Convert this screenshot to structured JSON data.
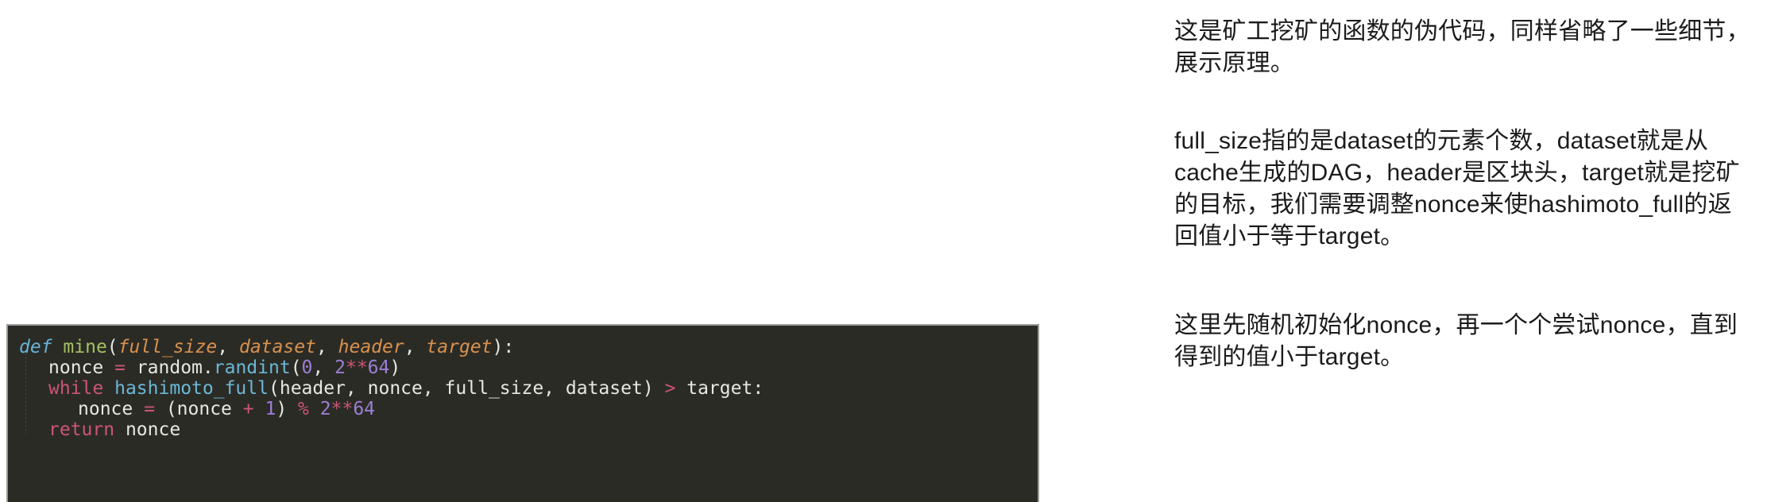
{
  "code_block": {
    "language": "python",
    "background_color": "#2B2B26",
    "lines": [
      {
        "indent": 0,
        "tokens": [
          {
            "t": "def",
            "c": "tk-def"
          },
          {
            "t": " ",
            "c": "tk-plain"
          },
          {
            "t": "mine",
            "c": "tk-fname"
          },
          {
            "t": "(",
            "c": "tk-punct"
          },
          {
            "t": "full_size",
            "c": "tk-param"
          },
          {
            "t": ", ",
            "c": "tk-punct"
          },
          {
            "t": "dataset",
            "c": "tk-param"
          },
          {
            "t": ", ",
            "c": "tk-punct"
          },
          {
            "t": "header",
            "c": "tk-param"
          },
          {
            "t": ", ",
            "c": "tk-punct"
          },
          {
            "t": "target",
            "c": "tk-param"
          },
          {
            "t": "):",
            "c": "tk-punct"
          }
        ]
      },
      {
        "indent": 1,
        "tokens": [
          {
            "t": "nonce",
            "c": "tk-plain"
          },
          {
            "t": " ",
            "c": "tk-plain"
          },
          {
            "t": "=",
            "c": "tk-op"
          },
          {
            "t": " random.",
            "c": "tk-plain"
          },
          {
            "t": "randint",
            "c": "tk-call"
          },
          {
            "t": "(",
            "c": "tk-punct"
          },
          {
            "t": "0",
            "c": "tk-num"
          },
          {
            "t": ", ",
            "c": "tk-punct"
          },
          {
            "t": "2",
            "c": "tk-num"
          },
          {
            "t": "**",
            "c": "tk-op"
          },
          {
            "t": "64",
            "c": "tk-num"
          },
          {
            "t": ")",
            "c": "tk-punct"
          }
        ]
      },
      {
        "indent": 1,
        "tokens": [
          {
            "t": "while",
            "c": "tk-kw"
          },
          {
            "t": " ",
            "c": "tk-plain"
          },
          {
            "t": "hashimoto_full",
            "c": "tk-call"
          },
          {
            "t": "(",
            "c": "tk-punct"
          },
          {
            "t": "header, nonce, full_size, dataset",
            "c": "tk-plain"
          },
          {
            "t": ")",
            "c": "tk-punct"
          },
          {
            "t": " ",
            "c": "tk-plain"
          },
          {
            "t": ">",
            "c": "tk-op"
          },
          {
            "t": " target:",
            "c": "tk-plain"
          }
        ]
      },
      {
        "indent": 2,
        "tokens": [
          {
            "t": "nonce",
            "c": "tk-plain"
          },
          {
            "t": " ",
            "c": "tk-plain"
          },
          {
            "t": "=",
            "c": "tk-op"
          },
          {
            "t": " (nonce ",
            "c": "tk-plain"
          },
          {
            "t": "+",
            "c": "tk-op"
          },
          {
            "t": " ",
            "c": "tk-plain"
          },
          {
            "t": "1",
            "c": "tk-num"
          },
          {
            "t": ") ",
            "c": "tk-punct"
          },
          {
            "t": "%",
            "c": "tk-op"
          },
          {
            "t": " ",
            "c": "tk-plain"
          },
          {
            "t": "2",
            "c": "tk-num"
          },
          {
            "t": "**",
            "c": "tk-op"
          },
          {
            "t": "64",
            "c": "tk-num"
          }
        ]
      },
      {
        "indent": 1,
        "tokens": [
          {
            "t": "return",
            "c": "tk-kw"
          },
          {
            "t": " nonce",
            "c": "tk-plain"
          }
        ]
      }
    ],
    "plain_text": "def mine(full_size, dataset, header, target):\n    nonce = random.randint(0, 2**64)\n    while hashimoto_full(header, nonce, full_size, dataset) > target:\n        nonce = (nonce + 1) % 2**64\n    return nonce"
  },
  "notes": {
    "paragraph_1": "这是矿工挖矿的函数的伪代码，同样省略了一些细节，展示原理。",
    "paragraph_2": "full_size指的是dataset的元素个数，dataset就是从cache生成的DAG，header是区块头，target就是挖矿的目标，我们需要调整nonce来使hashimoto_full的返回值小于等于target。",
    "paragraph_3": "这里先随机初始化nonce，再一个个尝试nonce，直到得到的值小于target。"
  }
}
